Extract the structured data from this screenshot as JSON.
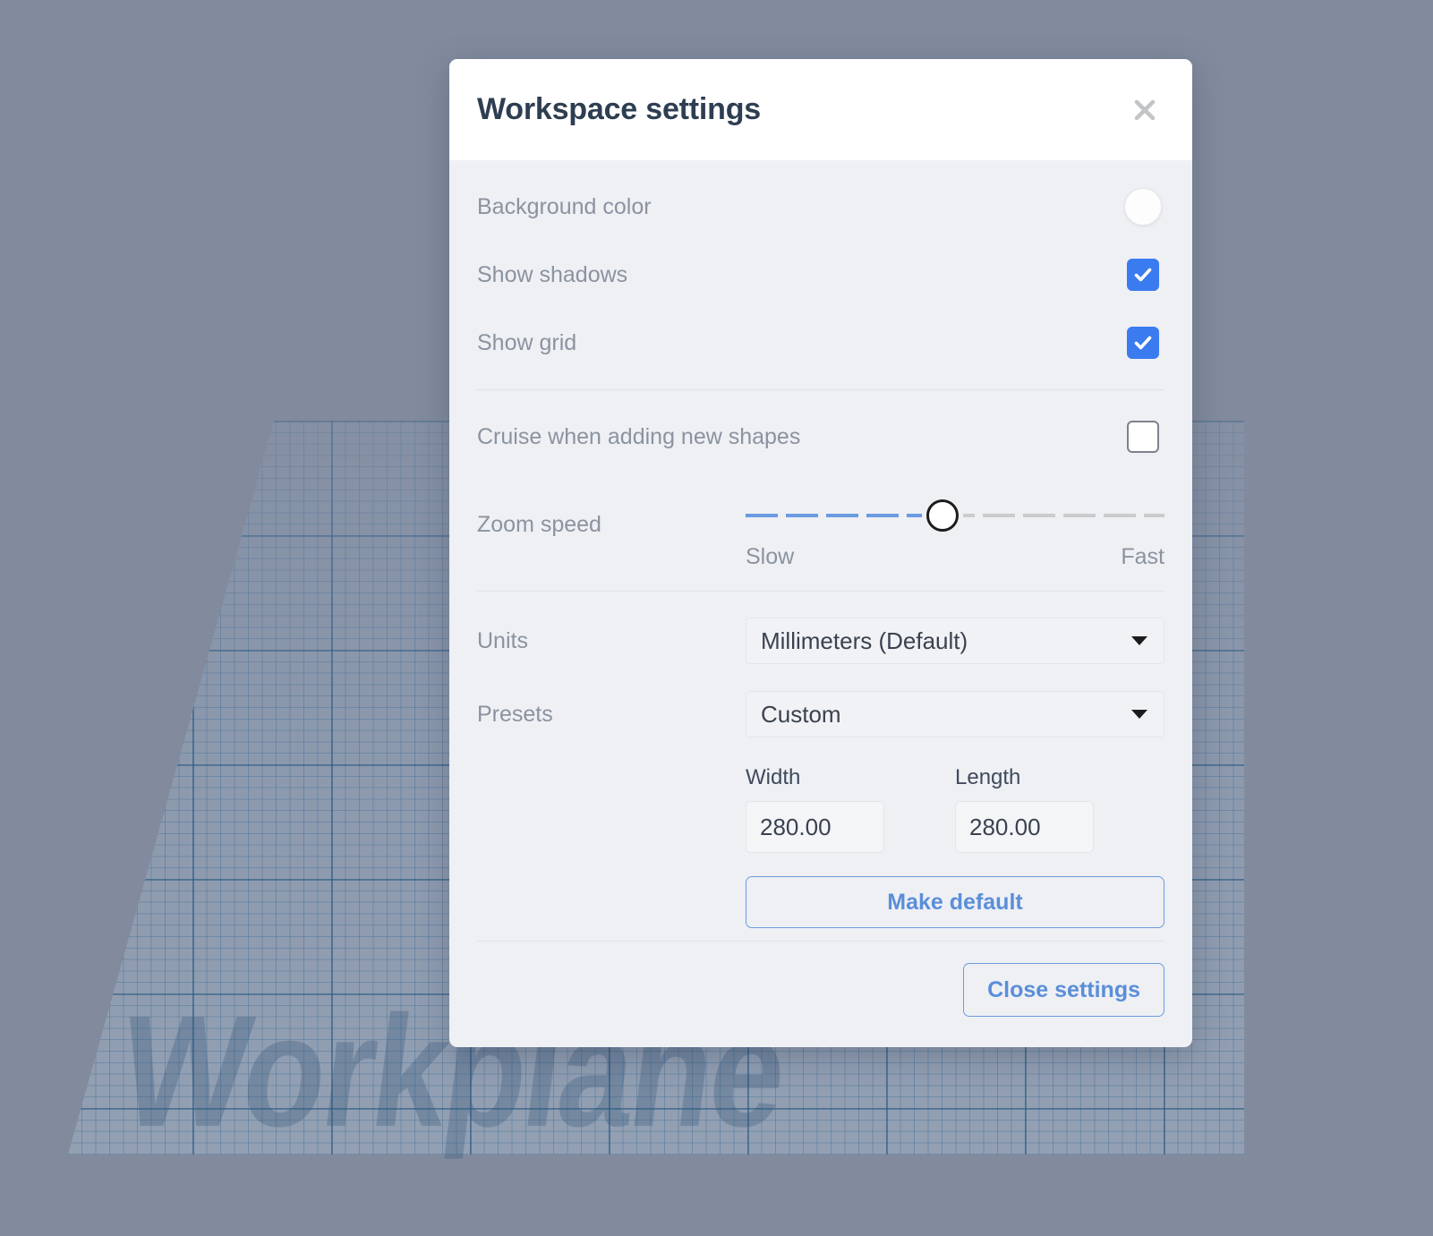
{
  "workspace": {
    "watermark_text": "Workplane",
    "background_color": "#828b9e",
    "plane_grid_color": "#2a5880"
  },
  "dialog": {
    "title": "Workspace settings",
    "close_icon": "close-icon",
    "settings": [
      {
        "label": "Background color",
        "control": "color-swatch",
        "value": "#FFFFFF"
      },
      {
        "label": "Show shadows",
        "control": "checkbox",
        "checked": true
      },
      {
        "label": "Show grid",
        "control": "checkbox",
        "checked": true
      }
    ],
    "cruise": {
      "label": "Cruise when adding new shapes",
      "checked": false
    },
    "zoom_speed": {
      "label": "Zoom speed",
      "min_label": "Slow",
      "max_label": "Fast",
      "percent": 47
    },
    "units": {
      "label": "Units",
      "value": "Millimeters (Default)",
      "caret_icon": "chevron-down-icon"
    },
    "presets": {
      "label": "Presets",
      "value": "Custom",
      "caret_icon": "chevron-down-icon"
    },
    "dimensions": {
      "width_label": "Width",
      "width_value": "280.00",
      "length_label": "Length",
      "length_value": "280.00"
    },
    "make_default_label": "Make default",
    "close_settings_label": "Close settings",
    "accent_color": "#3A7BF0",
    "button_color": "#5B8ED9"
  }
}
